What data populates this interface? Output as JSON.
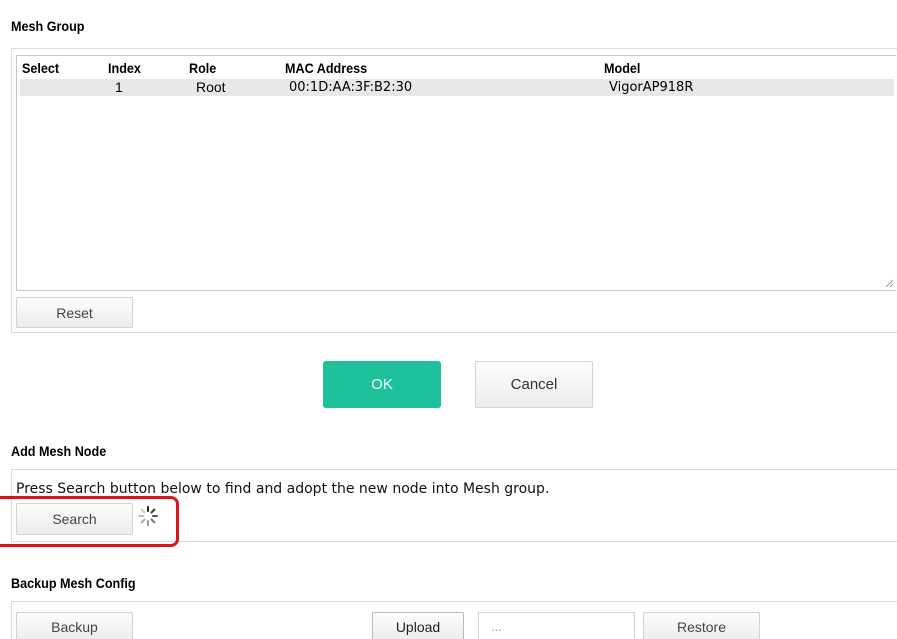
{
  "mesh_group": {
    "title": "Mesh Group",
    "columns": [
      "Select",
      "Index",
      "Role",
      "MAC Address",
      "Model"
    ],
    "rows": [
      {
        "select": "",
        "index": "1",
        "role": "Root",
        "mac": "00:1D:AA:3F:B2:30",
        "model": "VigorAP918R"
      }
    ],
    "reset_label": "Reset"
  },
  "actions": {
    "ok_label": "OK",
    "cancel_label": "Cancel",
    "ok_color": "#1ec19a"
  },
  "add_mesh_node": {
    "title": "Add Mesh Node",
    "description": "Press Search button below to find and adopt the new node into Mesh group.",
    "search_label": "Search",
    "loading_icon": "spinner-icon",
    "highlight_color": "#d9141c"
  },
  "backup_mesh_config": {
    "title": "Backup Mesh Config",
    "backup_label": "Backup",
    "upload_label": "Upload",
    "file_placeholder": "...",
    "restore_label": "Restore"
  }
}
